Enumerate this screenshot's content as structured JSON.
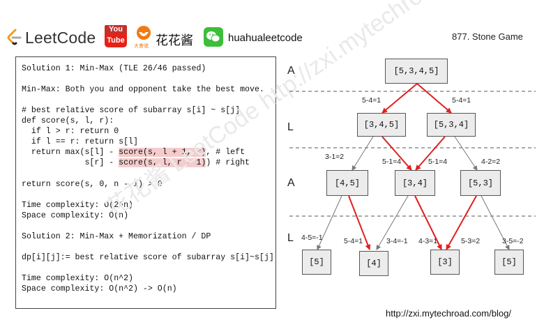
{
  "header": {
    "site_name": "LeetCode",
    "youtube_top": "You",
    "youtube_bottom": "Tube",
    "channel_badge": "大會號",
    "channel_name": "花花酱",
    "wechat_name": "huahualeetcode",
    "problem_title": "877. Stone Game"
  },
  "code_panel": {
    "lines": [
      "Solution 1: Min-Max (TLE 26/46 passed)",
      "",
      "Min-Max: Both you and opponent take the best move.",
      "",
      "# best relative score of subarray s[i] ~ s[j]",
      "def score(s, l, r):",
      "  if l > r: return 0",
      "  if l == r: return s[l]",
      "  return max(s[l] - ",
      "             s[r] - ",
      "",
      "return score(s, 0, n - 1) > 0",
      "",
      "Time complexity: O(2^n)",
      "Space complexity: O(n)",
      "",
      "Solution 2: Min-Max + Memorization / DP",
      "",
      "dp[i][j]:= best relative score of subarray s[i]~s[j]",
      "",
      "Time complexity: O(n^2)",
      "Space complexity: O(n^2) -> O(n)"
    ],
    "line8_hl": "score(s, l + 1, r)",
    "line8_tail": ", # left",
    "line9_hl": "score(s, l, r - 1)",
    "line9_tail": ") # right"
  },
  "watermark": "花花酱 LeetCode  http://zxi.mytechroad.com/blog",
  "tree": {
    "level_labels": [
      "A",
      "L",
      "A",
      "L"
    ],
    "nodes": {
      "root": "[5,3,4,5]",
      "l1_left": "[3,4,5]",
      "l1_right": "[5,3,4]",
      "l2_a": "[4,5]",
      "l2_b": "[3,4]",
      "l2_c": "[5,3]",
      "l3_a": "[5]",
      "l3_b": "[4]",
      "l3_c": "[3]",
      "l3_d": "[5]"
    },
    "edge_labels": {
      "root_left": "5-4=1",
      "root_right": "5-4=1",
      "l1l_a": "3-1=2",
      "l1l_b": "5-1=4",
      "l1r_b": "5-1=4",
      "l1r_c": "4-2=2",
      "a_l3a": "4-5=-1",
      "a_l3b": "5-4=1",
      "b_l3b": "3-4=-1",
      "b_l3c": "4-3=1",
      "c_l3c": "5-3=2",
      "c_l3d": "3-5=-2"
    },
    "best_edge_color": "#e02020",
    "other_edge_color": "#777777",
    "node_fill": "#ececec"
  },
  "footer": {
    "url": "http://zxi.mytechroad.com/blog/"
  }
}
